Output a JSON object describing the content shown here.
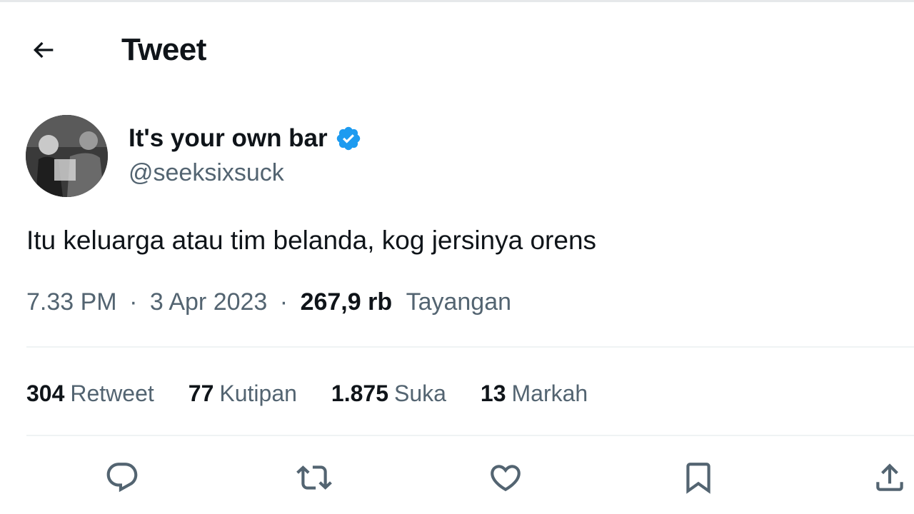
{
  "header": {
    "title": "Tweet",
    "back_icon": "arrow-left-icon"
  },
  "author": {
    "display_name": "It's your own bar",
    "handle": "@seeksixsuck",
    "verified": true,
    "verified_color": "#1d9bf0"
  },
  "tweet": {
    "text": "Itu keluarga atau tim belanda, kog jersinya orens",
    "time": "7.33 PM",
    "separator": "·",
    "date": "3 Apr 2023",
    "views_count": "267,9 rb",
    "views_label": "Tayangan"
  },
  "stats": [
    {
      "count": "304",
      "label": "Retweet"
    },
    {
      "count": "77",
      "label": "Kutipan"
    },
    {
      "count": "1.875",
      "label": "Suka"
    },
    {
      "count": "13",
      "label": "Markah"
    }
  ],
  "actions": [
    {
      "name": "reply",
      "icon": "comment-icon"
    },
    {
      "name": "retweet",
      "icon": "retweet-icon"
    },
    {
      "name": "like",
      "icon": "heart-icon"
    },
    {
      "name": "bookmark",
      "icon": "bookmark-icon"
    },
    {
      "name": "share",
      "icon": "share-icon"
    }
  ],
  "colors": {
    "text_primary": "#0f1419",
    "text_secondary": "#536471",
    "divider": "#eff3f4",
    "accent": "#1d9bf0"
  }
}
